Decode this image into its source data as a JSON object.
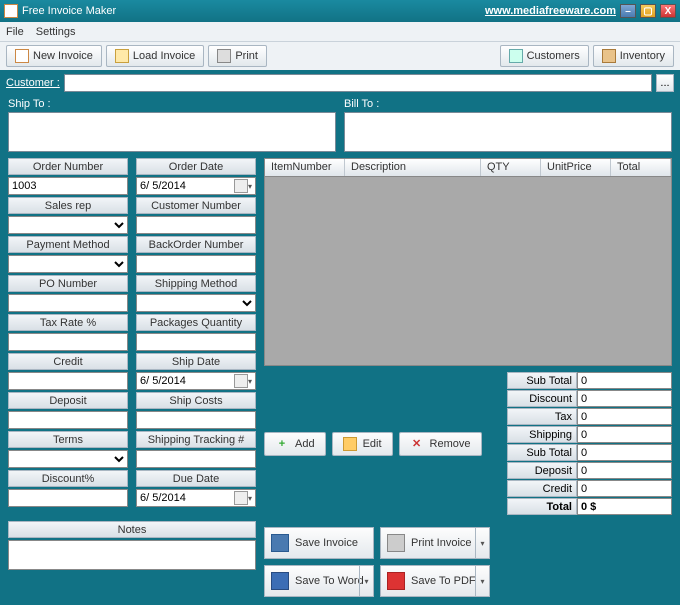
{
  "title": "Free Invoice Maker",
  "url": "www.mediafreeware.com",
  "menu": {
    "file": "File",
    "settings": "Settings"
  },
  "toolbar": {
    "new": "New Invoice",
    "load": "Load Invoice",
    "print": "Print",
    "customers": "Customers",
    "inventory": "Inventory"
  },
  "customer": {
    "label": "Customer :",
    "value": "",
    "dots": "..."
  },
  "shipTo": {
    "label": "Ship To :",
    "value": ""
  },
  "billTo": {
    "label": "Bill To :",
    "value": ""
  },
  "left": {
    "orderNumber": {
      "label": "Order Number",
      "value": "1003"
    },
    "salesRep": {
      "label": "Sales rep",
      "value": ""
    },
    "paymentMethod": {
      "label": "Payment Method",
      "value": ""
    },
    "poNumber": {
      "label": "PO Number",
      "value": ""
    },
    "taxRate": {
      "label": "Tax Rate %",
      "value": ""
    },
    "credit": {
      "label": "Credit",
      "value": ""
    },
    "deposit": {
      "label": "Deposit",
      "value": ""
    },
    "terms": {
      "label": "Terms",
      "value": ""
    },
    "discount": {
      "label": "Discount%",
      "value": ""
    }
  },
  "right": {
    "orderDate": {
      "label": "Order Date",
      "value": "6/  5/2014"
    },
    "customerNumber": {
      "label": "Customer Number",
      "value": ""
    },
    "backOrder": {
      "label": "BackOrder Number",
      "value": ""
    },
    "shippingMethod": {
      "label": "Shipping Method",
      "value": ""
    },
    "packagesQty": {
      "label": "Packages Quantity",
      "value": ""
    },
    "shipDate": {
      "label": "Ship Date",
      "value": "6/  5/2014"
    },
    "shipCosts": {
      "label": "Ship Costs",
      "value": ""
    },
    "tracking": {
      "label": "Shipping Tracking #",
      "value": ""
    },
    "dueDate": {
      "label": "Due Date",
      "value": "6/  5/2014"
    }
  },
  "grid": {
    "cols": {
      "itemNumber": "ItemNumber",
      "description": "Description",
      "qty": "QTY",
      "unitPrice": "UnitPrice",
      "total": "Total"
    }
  },
  "actions": {
    "add": "Add",
    "edit": "Edit",
    "remove": "Remove"
  },
  "big": {
    "save": "Save Invoice",
    "print": "Print Invoice",
    "word": "Save To Word",
    "pdf": "Save To PDF"
  },
  "notes": {
    "label": "Notes",
    "value": ""
  },
  "totals": {
    "subTotal": {
      "label": "Sub Total",
      "value": "0"
    },
    "discount": {
      "label": "Discount",
      "value": "0"
    },
    "tax": {
      "label": "Tax",
      "value": "0"
    },
    "shipping": {
      "label": "Shipping",
      "value": "0"
    },
    "subTotal2": {
      "label": "Sub Total",
      "value": "0"
    },
    "deposit": {
      "label": "Deposit",
      "value": "0"
    },
    "credit": {
      "label": "Credit",
      "value": "0"
    },
    "total": {
      "label": "Total",
      "value": "0 $"
    }
  }
}
